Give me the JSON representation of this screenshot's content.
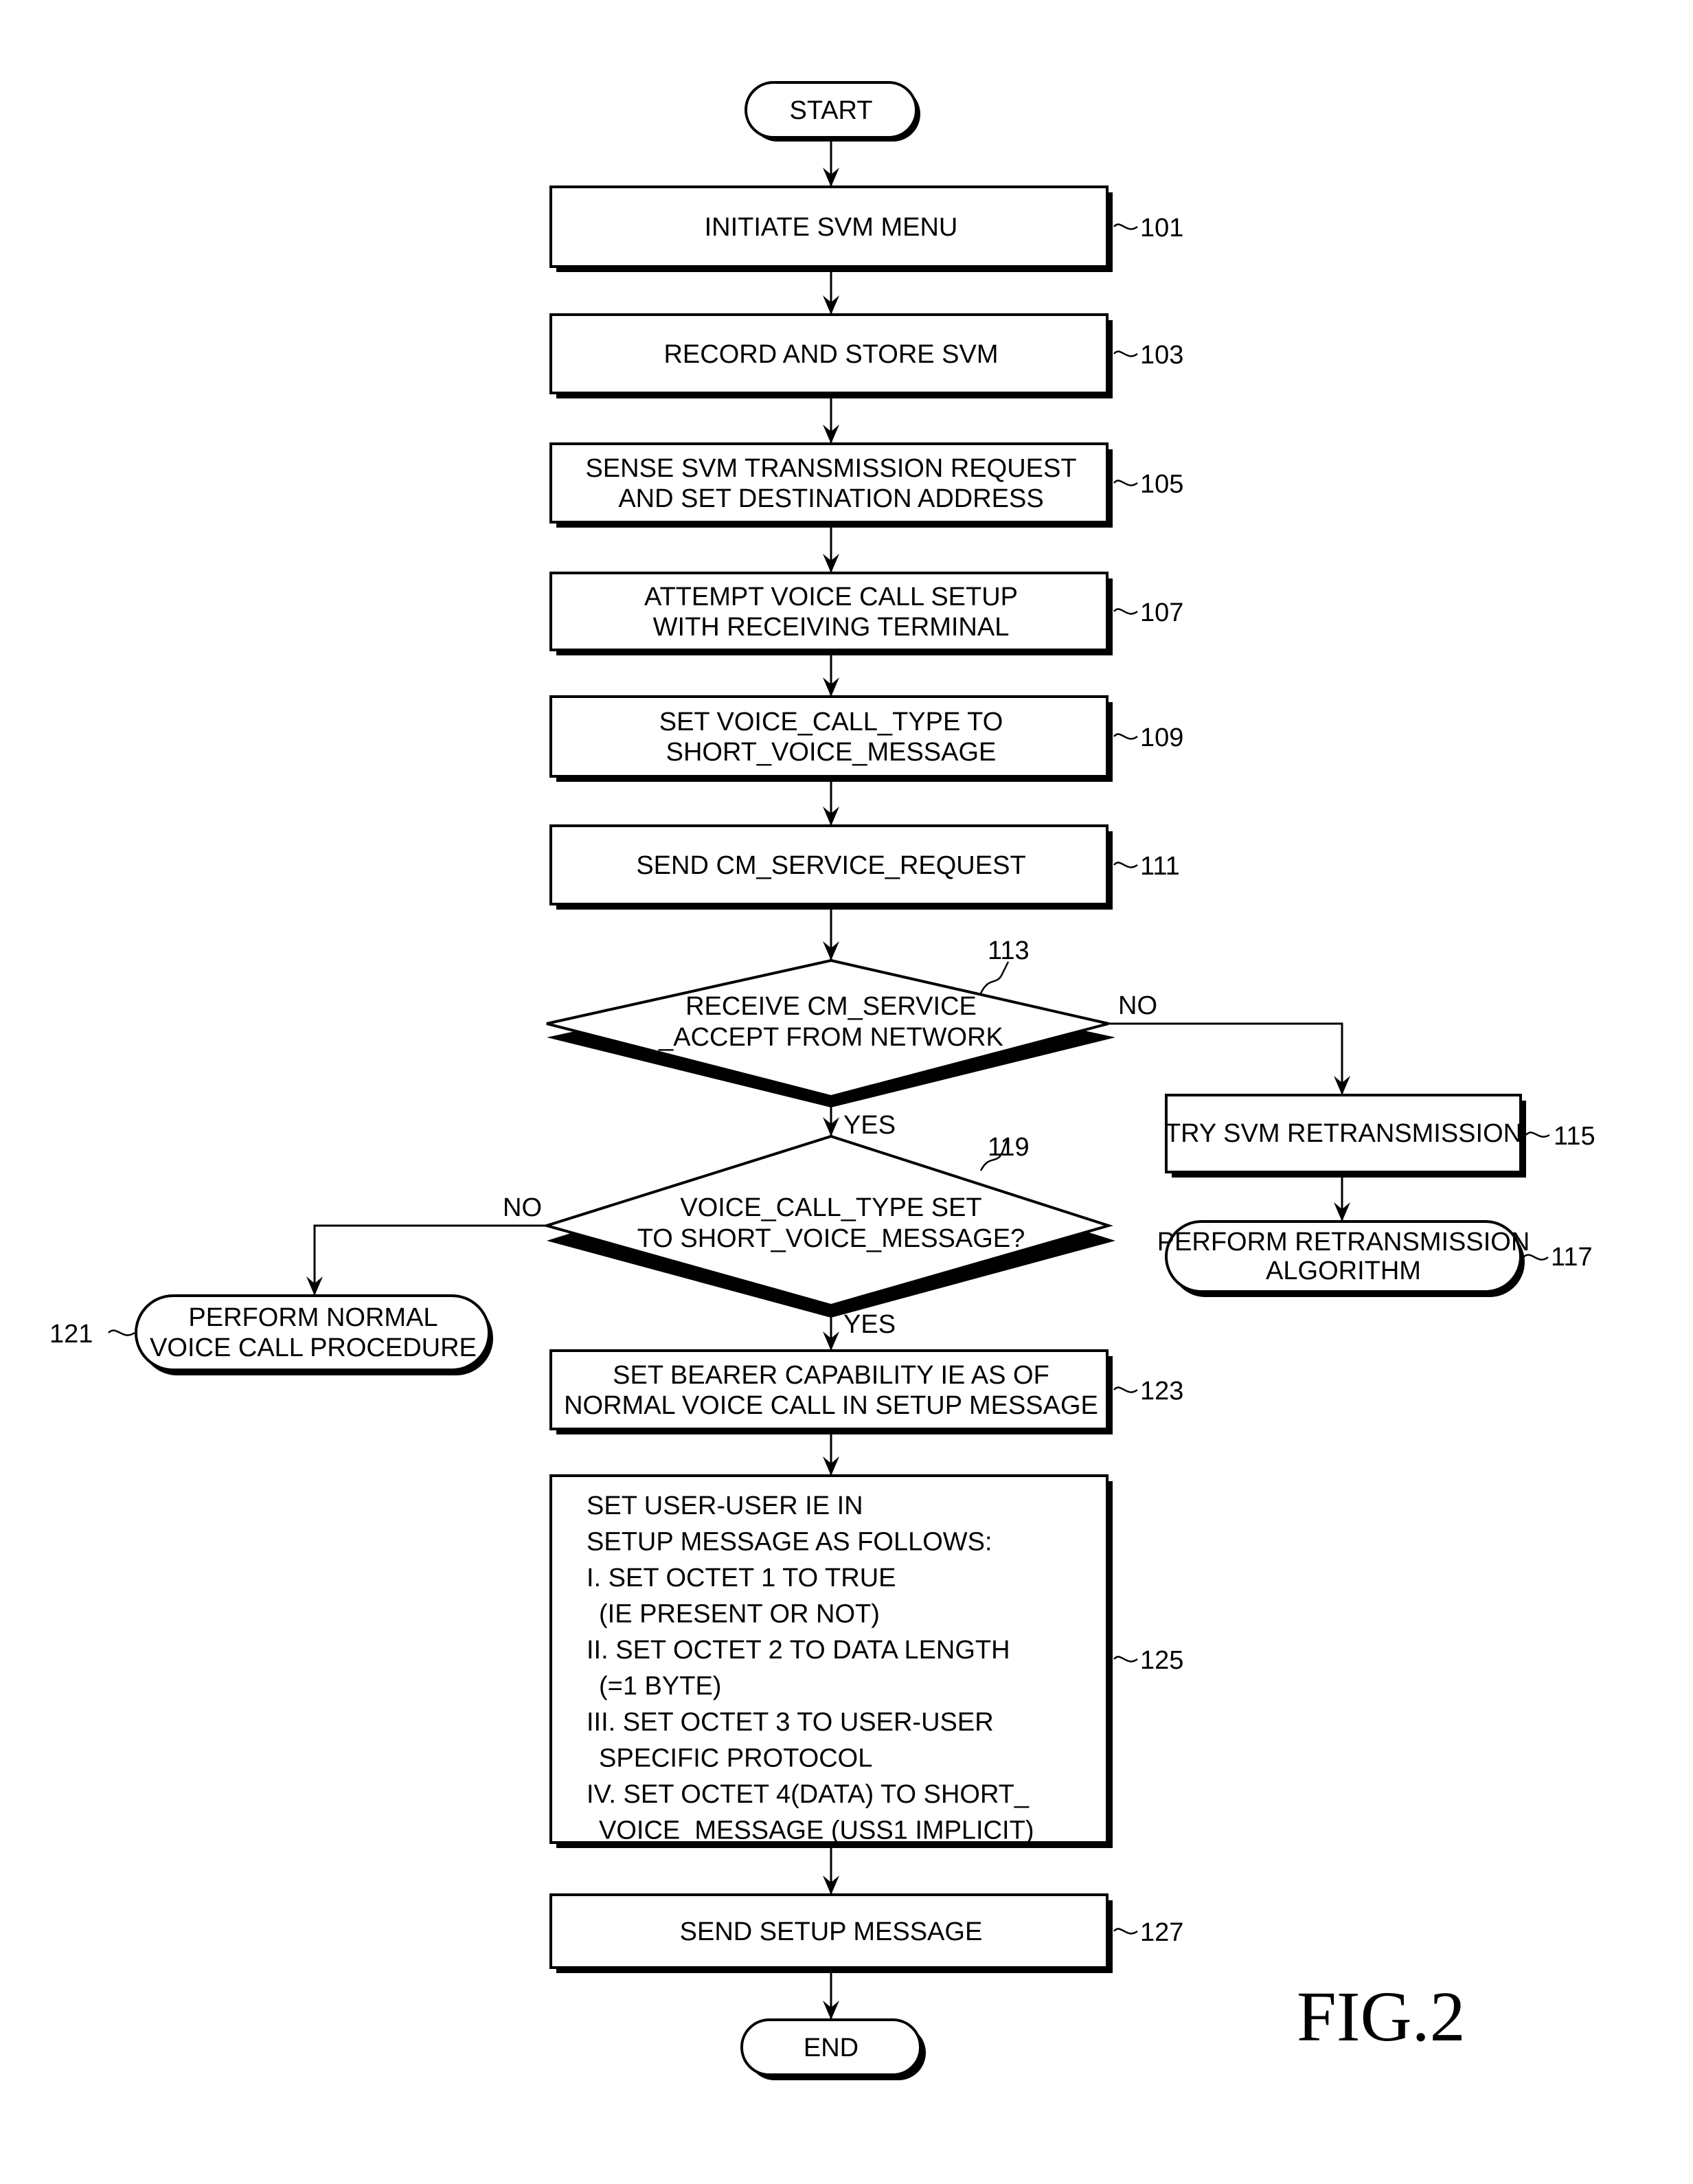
{
  "figure_label": "FIG.2",
  "nodes": {
    "start": {
      "label": "START"
    },
    "n101": {
      "ref": "101",
      "lines": [
        "INITIATE SVM MENU"
      ]
    },
    "n103": {
      "ref": "103",
      "lines": [
        "RECORD AND STORE SVM"
      ]
    },
    "n105": {
      "ref": "105",
      "lines": [
        "SENSE SVM TRANSMISSION REQUEST",
        "AND SET DESTINATION ADDRESS"
      ]
    },
    "n107": {
      "ref": "107",
      "lines": [
        "ATTEMPT VOICE CALL SETUP",
        "WITH RECEIVING TERMINAL"
      ]
    },
    "n109": {
      "ref": "109",
      "lines": [
        "SET VOICE_CALL_TYPE TO",
        "SHORT_VOICE_MESSAGE"
      ]
    },
    "n111": {
      "ref": "111",
      "lines": [
        "SEND CM_SERVICE_REQUEST"
      ]
    },
    "n113": {
      "ref": "113",
      "lines": [
        "RECEIVE CM_SERVICE",
        "_ACCEPT FROM NETWORK"
      ]
    },
    "n115": {
      "ref": "115",
      "lines": [
        "TRY SVM RETRANSMISSION"
      ]
    },
    "n117": {
      "ref": "117",
      "lines": [
        "PERFORM RETRANSMISSION",
        "ALGORITHM"
      ]
    },
    "n119": {
      "ref": "119",
      "lines": [
        "VOICE_CALL_TYPE SET",
        "TO SHORT_VOICE_MESSAGE?"
      ]
    },
    "n121": {
      "ref": "121",
      "lines": [
        "PERFORM NORMAL",
        "VOICE CALL PROCEDURE"
      ]
    },
    "n123": {
      "ref": "123",
      "lines": [
        "SET BEARER CAPABILITY IE AS OF",
        "NORMAL VOICE CALL IN SETUP MESSAGE"
      ]
    },
    "n125": {
      "ref": "125",
      "lines": [
        "SET USER-USER IE IN",
        "SETUP MESSAGE AS FOLLOWS:",
        "I. SET OCTET 1 TO TRUE",
        "(IE PRESENT OR NOT)",
        "II. SET OCTET 2 TO DATA LENGTH",
        "(=1 BYTE)",
        "III. SET OCTET 3 TO USER-USER",
        "SPECIFIC PROTOCOL",
        "IV. SET OCTET 4(DATA) TO  SHORT_",
        "VOICE_MESSAGE (USS1 IMPLICIT)"
      ]
    },
    "n127": {
      "ref": "127",
      "lines": [
        "SEND SETUP MESSAGE"
      ]
    },
    "end": {
      "label": "END"
    }
  },
  "edge_labels": {
    "n113_no": "NO",
    "n113_yes": "YES",
    "n119_no": "NO",
    "n119_yes": "YES"
  },
  "colors": {
    "ink": "#000000",
    "paper": "#ffffff"
  }
}
